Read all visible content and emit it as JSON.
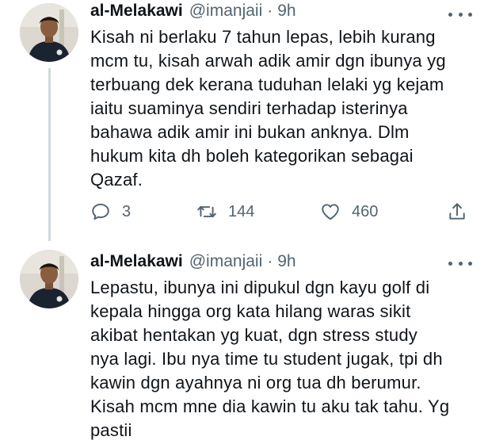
{
  "tweets": [
    {
      "author_name": "al-Melakawi",
      "handle": "@imanjaii",
      "separator": "·",
      "time": "9h",
      "text": "Kisah ni berlaku 7 tahun lepas, lebih kurang\nmcm tu, kisah arwah adik amir dgn ibunya yg\nterbuang dek kerana tuduhan lelaki yg kejam\niaitu suaminya sendiri terhadap isterinya\nbahawa adik amir ini bukan anknya. Dlm\nhukum kita dh boleh kategorikan sebagai\nQazaf.",
      "replies": "3",
      "retweets": "144",
      "likes": "460"
    },
    {
      "author_name": "al-Melakawi",
      "handle": "@imanjaii",
      "separator": "·",
      "time": "9h",
      "text": "Lepastu, ibunya ini dipukul dgn kayu golf di\nkepala hingga org kata hilang waras sikit\nakibat hentakan yg kuat, dgn stress study\nnya lagi. Ibu nya time tu student jugak, tpi dh\nkawin dgn ayahnya ni org tua dh berumur.\nKisah mcm mne dia kawin tu aku tak tahu. Yg\npastii"
    }
  ],
  "icons": {
    "reply": "reply-icon",
    "retweet": "retweet-icon",
    "like": "heart-icon",
    "share": "share-icon",
    "more": "more-icon"
  },
  "colors": {
    "text": "#0f1419",
    "secondary": "#536471",
    "thread_line": "#cfd9de"
  }
}
